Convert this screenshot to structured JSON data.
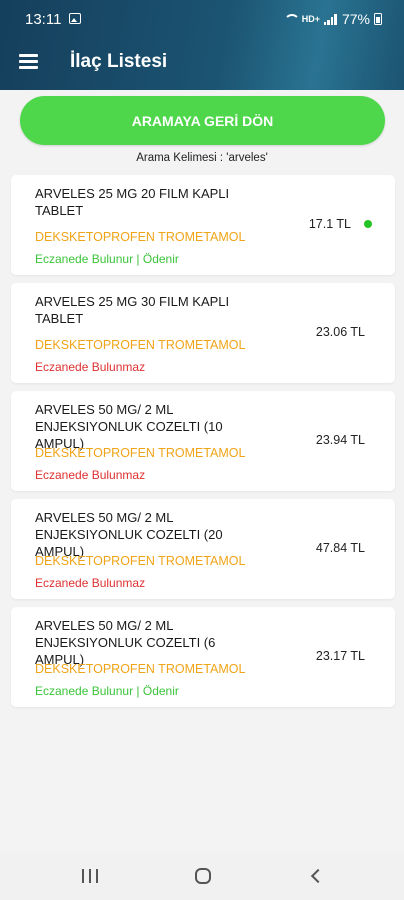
{
  "status_bar": {
    "time": "13:11",
    "network": "HD+",
    "battery": "77%"
  },
  "header": {
    "title": "İlaç Listesi"
  },
  "back_button_label": "ARAMAYA GERİ DÖN",
  "search_term": "Arama Kelimesi : 'arveles'",
  "colors": {
    "available": "#3bc33b",
    "unavailable": "#e03030",
    "ingredient": "#f0a418",
    "dot": "#22c422",
    "button": "#4ed74a"
  },
  "drugs": [
    {
      "name": "ARVELES 25 MG 20 FILM KAPLI TABLET",
      "ingredient": "DEKSKETOPROFEN TROMETAMOL",
      "availability": "Eczanede Bulunur | Ödenir",
      "available": true,
      "price": "17.1 TL",
      "dot": true
    },
    {
      "name": "ARVELES 25 MG 30 FILM KAPLI TABLET",
      "ingredient": "DEKSKETOPROFEN TROMETAMOL",
      "availability": "Eczanede Bulunmaz",
      "available": false,
      "price": "23.06 TL",
      "dot": false
    },
    {
      "name": "ARVELES 50 MG/ 2 ML ENJEKSIYONLUK COZELTI (10 AMPUL)",
      "ingredient": "DEKSKETOPROFEN TROMETAMOL",
      "availability": "Eczanede Bulunmaz",
      "available": false,
      "price": "23.94 TL",
      "dot": false
    },
    {
      "name": "ARVELES 50 MG/ 2 ML ENJEKSIYONLUK COZELTI (20 AMPUL)",
      "ingredient": "DEKSKETOPROFEN TROMETAMOL",
      "availability": "Eczanede Bulunmaz",
      "available": false,
      "price": "47.84 TL",
      "dot": false
    },
    {
      "name": "ARVELES 50 MG/ 2 ML ENJEKSIYONLUK COZELTI (6 AMPUL)",
      "ingredient": "DEKSKETOPROFEN TROMETAMOL",
      "availability": "Eczanede Bulunur | Ödenir",
      "available": true,
      "price": "23.17 TL",
      "dot": false
    }
  ]
}
